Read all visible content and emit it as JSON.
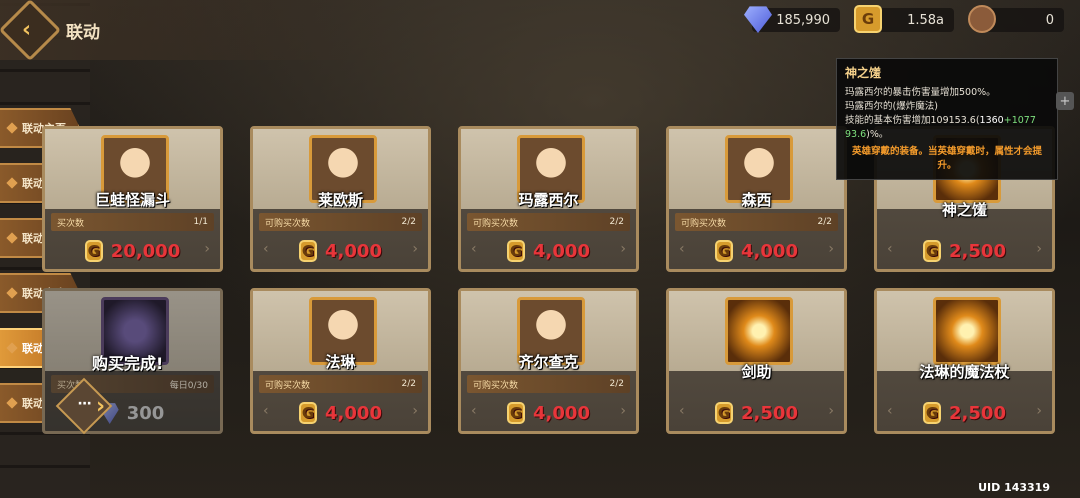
{
  "header": {
    "title": "联动"
  },
  "currencies": {
    "gems": "185,990",
    "coins": "1.58a",
    "bear": "0"
  },
  "nav": {
    "items": [
      {
        "label": "联动主页"
      },
      {
        "label": "联动召唤"
      },
      {
        "label": "联动副本"
      },
      {
        "label": "联动商店"
      },
      {
        "label": "联动兑换所"
      },
      {
        "label": "联动目录"
      }
    ]
  },
  "shop": {
    "limit_label": "可购买次数",
    "coin_glyph": "G",
    "items": [
      {
        "name": "巨蛙怪漏斗",
        "limit_label": "买次数",
        "count": "1/1",
        "price": "20,000"
      },
      {
        "name": "莱欧斯",
        "limit_label": "可购买次数",
        "count": "2/2",
        "price": "4,000"
      },
      {
        "name": "玛露西尔",
        "limit_label": "可购买次数",
        "count": "2/2",
        "price": "4,000"
      },
      {
        "name": "森西",
        "limit_label": "可购买次数",
        "count": "2/2",
        "price": "4,000"
      },
      {
        "name": "神之馐",
        "price": "2,500"
      },
      {
        "name": "",
        "limit_label": "买次数",
        "count": "每日0/30",
        "price": "300"
      },
      {
        "name": "法琳",
        "limit_label": "可购买次数",
        "count": "2/2",
        "price": "4,000"
      },
      {
        "name": "齐尔查克",
        "limit_label": "可购买次数",
        "count": "2/2",
        "price": "4,000"
      },
      {
        "name": "剑助",
        "price": "2,500"
      },
      {
        "name": "法琳的魔法杖",
        "price": "2,500"
      }
    ],
    "sold_text": "购买完成!"
  },
  "tooltip": {
    "title": "神之馐",
    "line1": "玛露西尔的暴击伤害量增加500%。",
    "line2": "玛露西尔的(爆炸魔法)",
    "line3_prefix": "技能的基本伤害增加109153.6(",
    "line3_base": "1360",
    "line3_plus": "+",
    "line3_bonus": "1077",
    "line4_bonus": "93.6",
    "line4_suffix": ")%。",
    "warning": "英雄穿戴的装备。当英雄穿戴时，属性才会提升。"
  },
  "footer": {
    "uid": "UID 143319"
  }
}
